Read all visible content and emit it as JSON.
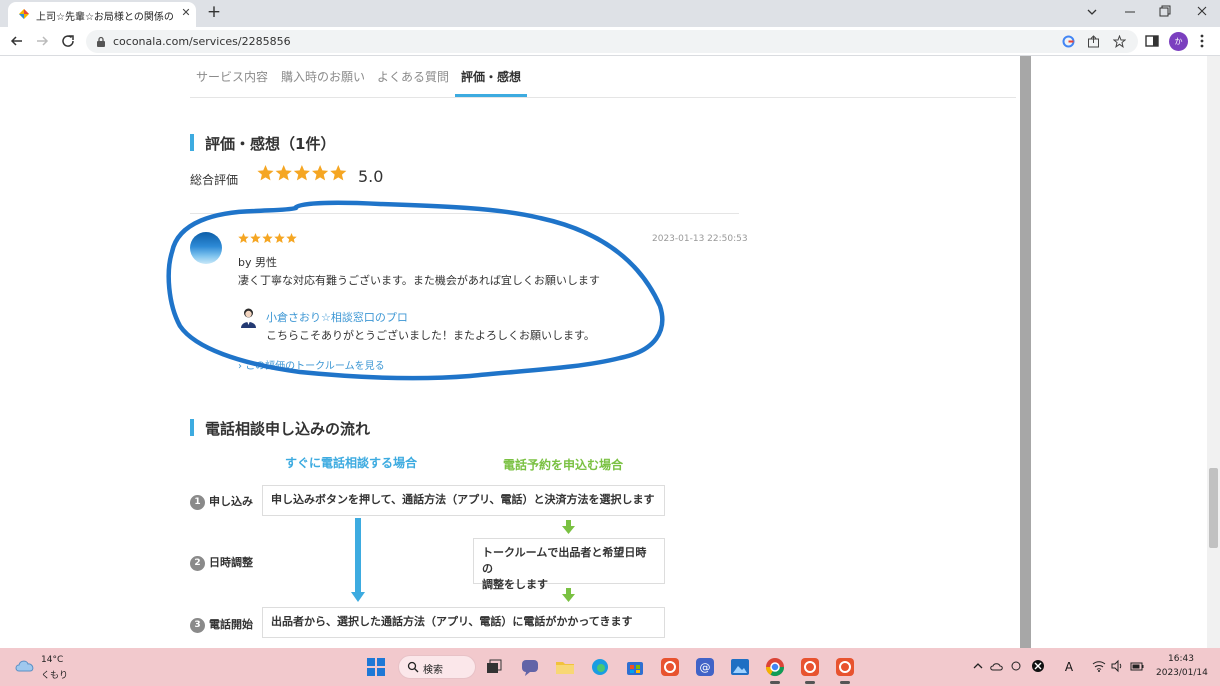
{
  "browser": {
    "tab_title": "上司☆先輩☆お局様との関係のお悩",
    "url": "coconala.com/services/2285856",
    "profile_initial": "か"
  },
  "page": {
    "tabs": [
      "サービス内容",
      "購入時のお願い",
      "よくある質問",
      "評価・感想"
    ],
    "active_tab": "評価・感想",
    "reviews": {
      "section_title": "評価・感想（1件）",
      "overall_label": "総合評価",
      "overall_stars": 5,
      "overall_score": "5.0",
      "items": [
        {
          "stars": 5,
          "date": "2023-01-13 22:50:53",
          "author": "by 男性",
          "text": "凄く丁寧な対応有難うございます。また機会があれば宜しくお願いします",
          "seller_name": "小倉さおり☆相談窓口のプロ",
          "seller_reply": "こちらこそありがとうございました！またよろしくお願いします。",
          "talkroom_link": "この評価のトークルームを見る"
        }
      ]
    },
    "flow": {
      "section_title": "電話相談申し込みの流れ",
      "col_immediate": "すぐに電話相談する場合",
      "col_reserve": "電話予約を申込む場合",
      "colors": {
        "immediate": "#3dabe0",
        "reserve": "#7ac142"
      },
      "steps": [
        {
          "num": "1",
          "label": "申し込み",
          "text": "申し込みボタンを押して、通話方法（アプリ、電話）と決済方法を選択します"
        },
        {
          "num": "2",
          "label": "日時調整",
          "text": "トークルームで出品者と希望日時の\n調整をします"
        },
        {
          "num": "3",
          "label": "電話開始",
          "text": "出品者から、選択した通話方法（アプリ、電話）に電話がかかってきます"
        }
      ]
    }
  },
  "taskbar": {
    "temperature": "14°C",
    "weather": "くもり",
    "search_label": "検索",
    "time": "16:43",
    "date": "2023/01/14"
  }
}
